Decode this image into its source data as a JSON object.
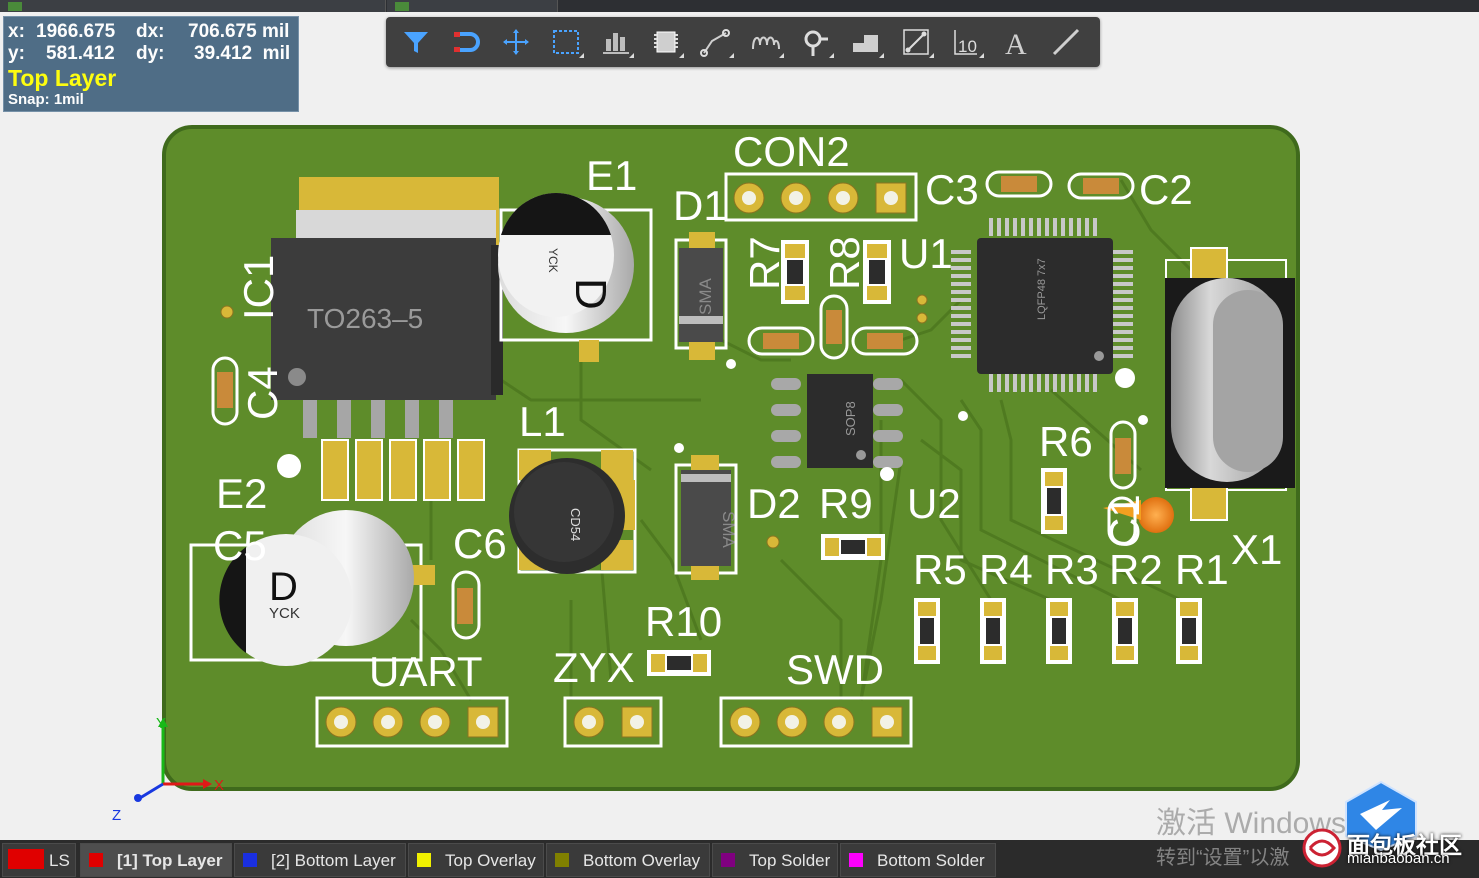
{
  "doc_tabs": [
    {
      "label": ""
    },
    {
      "label": ""
    }
  ],
  "toolbar": {
    "tools": [
      {
        "name": "filter-icon"
      },
      {
        "name": "snap-magnet-icon"
      },
      {
        "name": "crosshair-move-icon"
      },
      {
        "name": "select-rect-icon"
      },
      {
        "name": "align-icon"
      },
      {
        "name": "place-component-icon"
      },
      {
        "name": "route-track-icon"
      },
      {
        "name": "interactive-route-icon"
      },
      {
        "name": "place-via-icon"
      },
      {
        "name": "place-polygon-icon"
      },
      {
        "name": "place-region-icon"
      },
      {
        "name": "designator-icon"
      },
      {
        "name": "place-string-icon"
      },
      {
        "name": "place-line-icon"
      }
    ],
    "designator_text": "10",
    "string_text": "A"
  },
  "hud": {
    "x_label": "x:",
    "x_value": "1966.675",
    "dx_label": "dx:",
    "dx_value": "706.675 mil",
    "y_label": "y:",
    "y_value": "581.412",
    "dy_label": "dy:",
    "dy_value": "39.412  mil",
    "layer": "Top Layer",
    "snap": "Snap: 1mil"
  },
  "pcb": {
    "colors": {
      "board": "#5e8c2a",
      "outline": "#3f6a1c",
      "silk": "#ffffff",
      "pad": "#d8b838",
      "copper": "#b8a02a"
    },
    "designators": {
      "con2": "CON2",
      "e1": "E1",
      "d1": "D1",
      "c3": "C3",
      "c2": "C2",
      "r7": "R7",
      "r8": "R8",
      "u1": "U1",
      "ic1": "IC1",
      "c4": "C4",
      "l1": "L1",
      "e2": "E2",
      "c5": "C5",
      "c6": "C6",
      "d2": "D2",
      "r9": "R9",
      "u2": "U2",
      "r6": "R6",
      "c1": "C1",
      "x1": "X1",
      "r5": "R5",
      "r4": "R4",
      "r3": "R3",
      "r2": "R2",
      "r1": "R1",
      "r10": "R10",
      "uart": "UART",
      "zyx": "ZYX",
      "swd": "SWD"
    },
    "body_text": {
      "to263": "TO263–5",
      "e1_d": "D",
      "e1_yck": "YCK",
      "e2_d": "D",
      "e2_yck": "YCK",
      "sma": "SMA",
      "cd54": "CD54",
      "sop8": "SOP8",
      "lqfp": "LQFP48 7x7"
    }
  },
  "axis": {
    "y": "Y",
    "x": "X",
    "z": "Z"
  },
  "layers": [
    {
      "label": "LS",
      "color": "#e00000"
    },
    {
      "label": "[1] Top Layer",
      "color": "#e00000"
    },
    {
      "label": "[2] Bottom Layer",
      "color": "#1a2fe0"
    },
    {
      "label": "Top Overlay",
      "color": "#f0f000"
    },
    {
      "label": "Bottom Overlay",
      "color": "#808000"
    },
    {
      "label": "Top Solder",
      "color": "#800080"
    },
    {
      "label": "Bottom Solder",
      "color": "#ff00ff"
    }
  ],
  "watermark": {
    "line1": "激活 Windows",
    "line2": "转到“设置”以激"
  },
  "brand": {
    "cn": "面包板社区",
    "en": "mianbaoban.cn"
  }
}
